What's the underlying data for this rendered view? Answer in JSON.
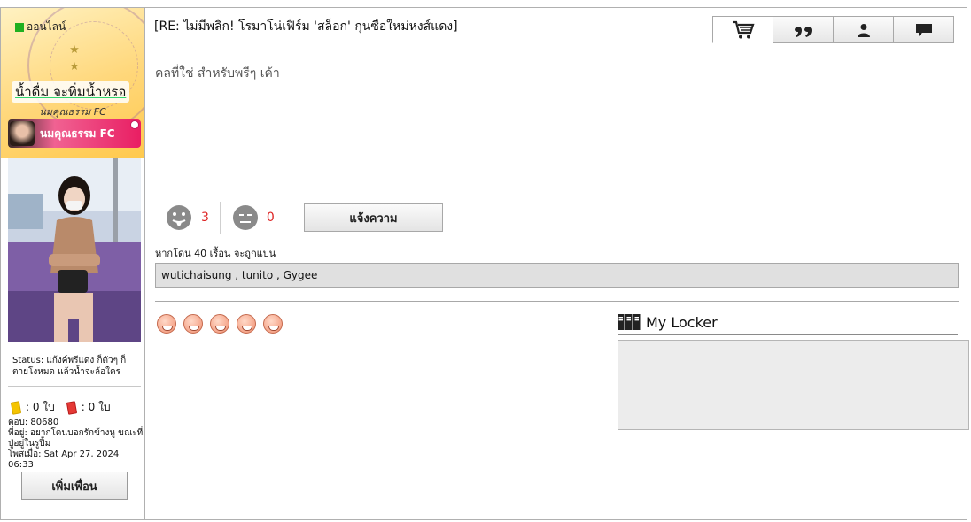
{
  "sidebar": {
    "online_label": "ออนไลน์",
    "stars": [
      "★",
      "★"
    ],
    "username": "น้ำดื่ม จะทิ่มน้ำหรอ",
    "user_title": "นมคุณธรรม FC",
    "club_banner": "นมคุณธรรม FC",
    "status": "Status: แก้งค์พรีแดง ก็ตัวๆ ก็ตายโงหมด แล้วน้ำจะล้อใคร",
    "yellow_cards": ": 0 ใบ",
    "red_cards": ": 0 ใบ",
    "replies": "ตอบ: 80680",
    "location": "ที่อยู่: อยากโดนบอกรักข้างหู ขณะที่ปู่อยู่ในรูปิ้ม",
    "posted": "โพสเมื่อ: Sat Apr 27, 2024 06:33",
    "add_friend": "เพิ่มเพื่อน"
  },
  "post": {
    "title": "[RE: ไม่มีพลิก! โรมาโน่เฟิร์ม 'สล็อก' กุนซือใหม่หงส์แดง]",
    "body": "คลที่ใช่ สำหรับพรีๆ เค้า"
  },
  "toolbar": {
    "icons": [
      "cart-icon",
      "quote-icon",
      "profile-icon",
      "message-icon"
    ]
  },
  "votes": {
    "like_count": "3",
    "dislike_count": "0",
    "report_label": "แจ้งความ"
  },
  "ban_note": "หากโดน 40 เรื้อน จะถูกแบน",
  "voters": "wutichaisung , tunito , Gygee",
  "reactions_count": 5,
  "locker": {
    "title": "My Locker"
  },
  "colors": {
    "online": "#20b020",
    "vote_count": "#dd2222",
    "yellow_card": "#f5c400",
    "red_card": "#e53935"
  }
}
